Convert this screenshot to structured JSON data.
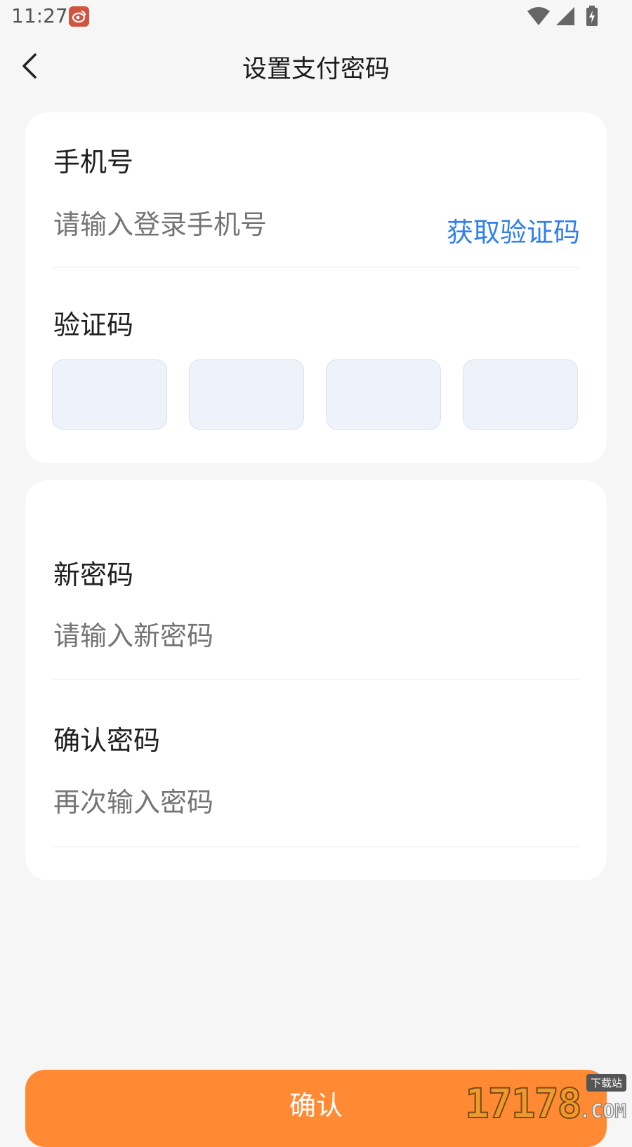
{
  "status_bar": {
    "time": "11:27",
    "app_icon": "weibo-icon",
    "icons": [
      "wifi-icon",
      "signal-icon",
      "battery-charging-icon"
    ]
  },
  "header": {
    "title": "设置支付密码",
    "back_icon": "chevron-left-icon"
  },
  "phone_section": {
    "label": "手机号",
    "placeholder": "请输入登录手机号",
    "get_code_label": "获取验证码"
  },
  "code_section": {
    "label": "验证码",
    "box_count": 4,
    "values": [
      "",
      "",
      "",
      ""
    ]
  },
  "password_section": {
    "new_label": "新密码",
    "new_placeholder": "请输入新密码",
    "confirm_label": "确认密码",
    "confirm_placeholder": "再次输入密码"
  },
  "confirm_button": {
    "label": "确认"
  },
  "colors": {
    "accent_orange": "#ff8a33",
    "link_blue": "#2f7ff0",
    "placeholder_gray": "#b8bcc6",
    "code_box_bg": "#eef2fb",
    "page_bg": "#f6f6f6"
  },
  "watermark": {
    "digits": "17178",
    "tag": "下载站",
    "domain_suffix": ".COM"
  }
}
